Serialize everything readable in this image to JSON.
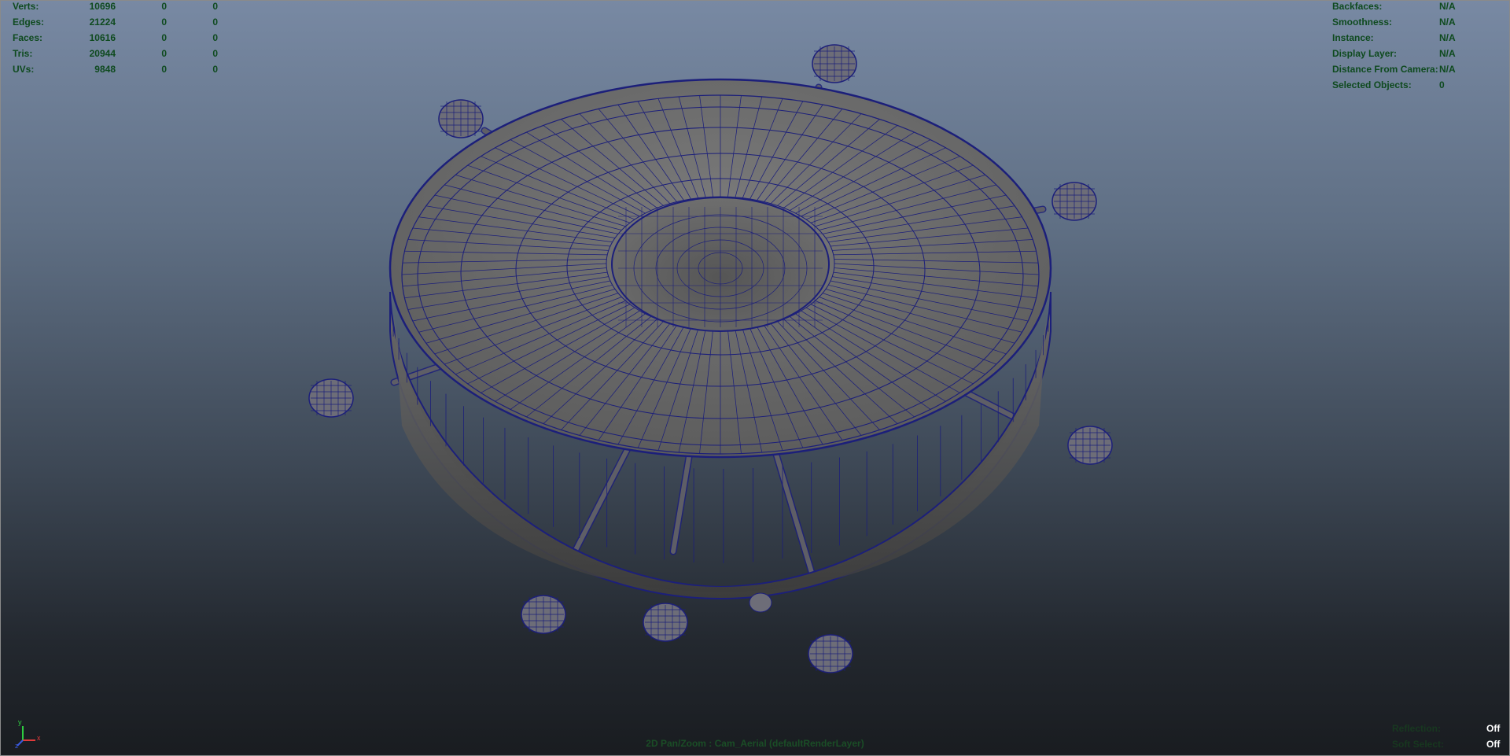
{
  "hud_stats": [
    {
      "label": "Verts:",
      "values": [
        "10696",
        "0",
        "0"
      ]
    },
    {
      "label": "Edges:",
      "values": [
        "21224",
        "0",
        "0"
      ]
    },
    {
      "label": "Faces:",
      "values": [
        "10616",
        "0",
        "0"
      ]
    },
    {
      "label": "Tris:",
      "values": [
        "20944",
        "0",
        "0"
      ]
    },
    {
      "label": "UVs:",
      "values": [
        "9848",
        "0",
        "0"
      ]
    }
  ],
  "hud_info": [
    {
      "label": "Backfaces:",
      "value": "N/A"
    },
    {
      "label": "Smoothness:",
      "value": "N/A"
    },
    {
      "label": "Instance:",
      "value": "N/A"
    },
    {
      "label": "Display Layer:",
      "value": "N/A"
    },
    {
      "label": "Distance From Camera:",
      "value": "N/A"
    },
    {
      "label": "Selected Objects:",
      "value": "0"
    }
  ],
  "hud_toggles": [
    {
      "label": "Reflection:",
      "value": "Off"
    },
    {
      "label": "Soft Select:",
      "value": "Off"
    }
  ],
  "camera_label": "2D Pan/Zoom : Cam_Aerial (defaultRenderLayer)",
  "axis": {
    "y": "y",
    "x": "x",
    "z": "z"
  },
  "colors": {
    "wire": "#1c1f7a",
    "mesh": "#6a6a6a",
    "hud_text": "#0e4a1e",
    "bg_top": "#7889a3",
    "bg_bottom": "#191c20"
  }
}
